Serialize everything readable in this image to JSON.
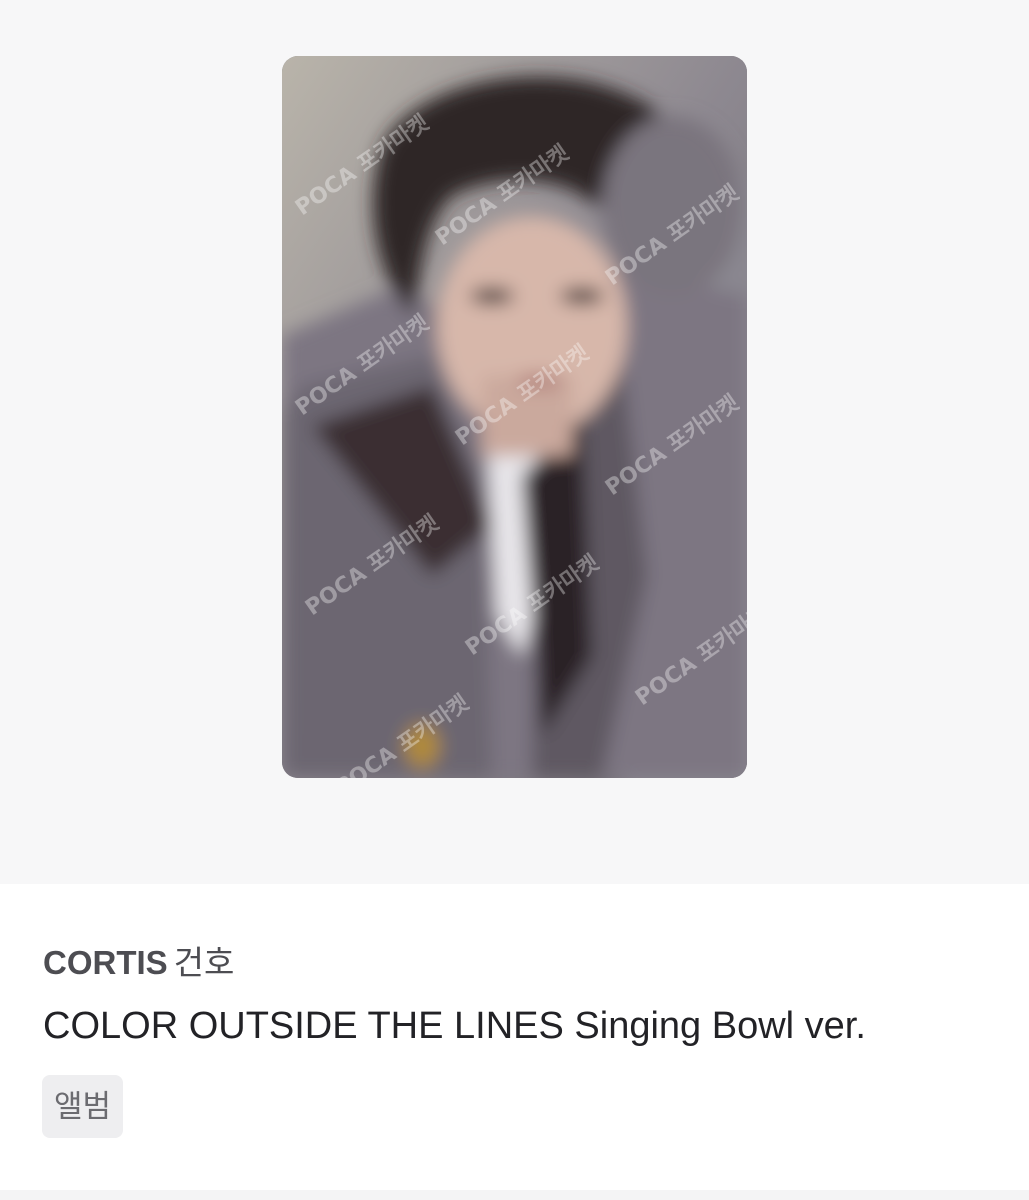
{
  "product": {
    "image": {
      "description_icon": "photocard-image",
      "watermark": "POCA 포카마켓"
    },
    "group": "CORTIS",
    "member": "건호",
    "album_title": "COLOR OUTSIDE THE LINES Singing Bowl ver.",
    "tag": "앨범"
  },
  "colors": {
    "hero_background": "#f7f7f8",
    "title_text": "#222226",
    "subtitle_text": "#4d4d52",
    "tag_background": "#eeeef0",
    "tag_text": "#6b6b70"
  }
}
